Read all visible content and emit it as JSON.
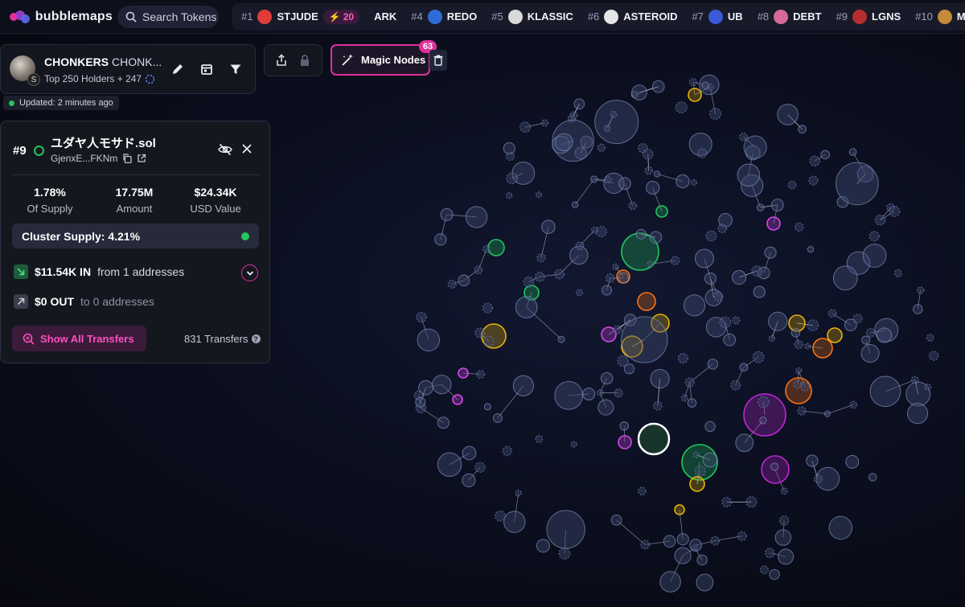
{
  "app": {
    "name": "bubblemaps",
    "search_placeholder": "Search Tokens"
  },
  "ticker": [
    {
      "rank": "#1",
      "name": "STJUDE",
      "badge": "20",
      "logo_color": "#e23b3b"
    },
    {
      "rank": "",
      "name": "ARK",
      "badge": "",
      "logo_color": ""
    },
    {
      "rank": "#4",
      "name": "REDO",
      "badge": "",
      "logo_color": "#2f6bd8"
    },
    {
      "rank": "#5",
      "name": "KLASSIC",
      "badge": "",
      "logo_color": "#d9d9d9"
    },
    {
      "rank": "#6",
      "name": "ASTEROID",
      "badge": "",
      "logo_color": "#e6e6e6"
    },
    {
      "rank": "#7",
      "name": "UB",
      "badge": "",
      "logo_color": "#3a5ad8"
    },
    {
      "rank": "#8",
      "name": "DEBT",
      "badge": "",
      "logo_color": "#d46a9a"
    },
    {
      "rank": "#9",
      "name": "LGNS",
      "badge": "",
      "logo_color": "#b52e2e"
    },
    {
      "rank": "#10",
      "name": "MYS",
      "badge": "",
      "logo_color": "#c7893a"
    }
  ],
  "token": {
    "name": "CHONKERS",
    "symbol": "CHONK...",
    "holders_text": "Top 250 Holders + 247",
    "chain_glyph": "S",
    "updated_text": "Updated: 2 minutes ago"
  },
  "magic_nodes": {
    "label": "Magic Nodes",
    "count": "63"
  },
  "wallet": {
    "rank": "#9",
    "name": "ユダヤ人モサド.sol",
    "address": "GjenxE...FKNm",
    "stats": [
      {
        "value": "1.78%",
        "label": "Of Supply"
      },
      {
        "value": "17.75M",
        "label": "Amount"
      },
      {
        "value": "$24.34K",
        "label": "USD Value"
      }
    ],
    "cluster_supply": "Cluster Supply: 4.21%",
    "inflow": {
      "amount": "$11.54K IN",
      "text": "from 1 addresses"
    },
    "outflow": {
      "amount": "$0 OUT",
      "text": "to 0 addresses"
    },
    "show_all_label": "Show All Transfers",
    "transfers_count": "831 Transfers"
  },
  "colors": {
    "accent": "#e0309b",
    "green": "#22c55e",
    "bubble": "#3d4a6e",
    "bubble_stroke": "#7f8fbd"
  }
}
